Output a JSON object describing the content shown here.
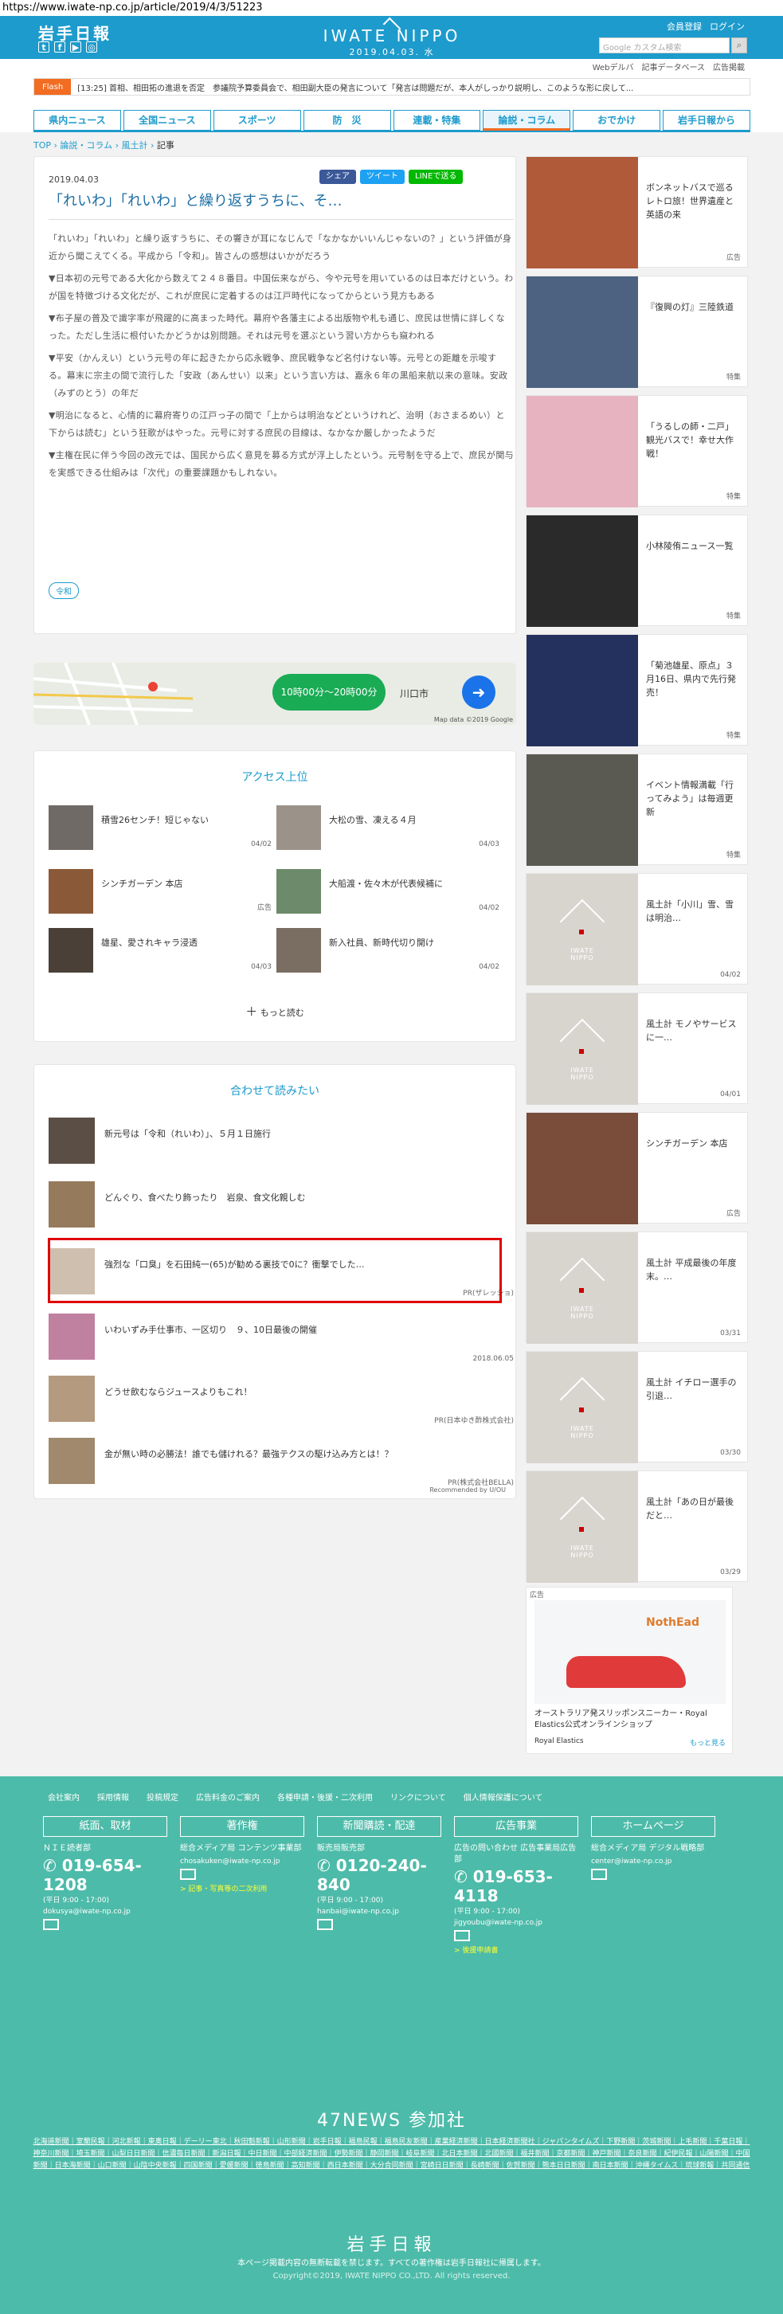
{
  "url": "https://www.iwate-np.co.jp/article/2019/4/3/51223",
  "header": {
    "logo": "岩手日報",
    "site_name": "IWATE NIPPO",
    "date": "2019.04.03. 水",
    "member_register": "会員登録",
    "login": "ログイン",
    "search_placeholder": "Google カスタム検索",
    "subnav": [
      "Webデルバ",
      "記事データベース",
      "広告掲載"
    ]
  },
  "flash": {
    "label": "Flash",
    "text": "[13:25] 首相、相田拓の進退を否定　参議院予算委員会で、相田副大臣の発言について「発言は問題だが、本人がしっかり説明し、このような形に戻して..."
  },
  "nav": [
    "県内ニュース",
    "全国ニュース",
    "スポーツ",
    "防　災",
    "連載・特集",
    "論説・コラム",
    "おでかけ",
    "岩手日報から"
  ],
  "breadcrumb": [
    "TOP",
    "論説・コラム",
    "風土計",
    "記事"
  ],
  "article": {
    "date": "2019.04.03",
    "share": [
      "シェア",
      "ツイート",
      "LINEで送る"
    ],
    "title": "「れいわ」「れいわ」と繰り返すうちに、そ…",
    "paragraphs": [
      "「れいわ」「れいわ」と繰り返すうちに、その響きが耳になじんで「なかなかいいんじゃないの？」という評価が身近から聞こえてくる。平成から「令和」。皆さんの感想はいかがだろう",
      "▼日本初の元号である大化から数えて２４８番目。中国伝来ながら、今や元号を用いているのは日本だけという。わが国を特徴づける文化だが、これが庶民に定着するのは江戸時代になってからという見方もある",
      "▼布子屋の普及で識字率が飛躍的に高まった時代。幕府や各藩主による出版物や札も通じ、庶民は世情に詳しくなった。ただし生活に根付いたかどうかは別問題。それは元号を選ぶという習い方からも窺われる",
      "▼平安（かんえい）という元号の年に起きたから応永戦争、庶民戦争など名付けない等。元号との距離を示唆する。幕末に宗主の間で流行した「安政（あんせい）以来」という言い方は、嘉永６年の黒船来航以来の意味。安政（みずのとう）の年だ",
      "▼明治になると、心情的に幕府寄りの江戸っ子の間で「上からは明治などというけれど、治明（おさまるめい）と下からは読む」という狂歌がはやった。元号に対する庶民の目線は、なかなか厳しかったようだ",
      "▼主権在民に伴う今回の改元では、国民から広く意見を募る方式が浮上したという。元号制を守る上で、庶民が関与を実感できる仕組みは「次代」の重要課題かもしれない。"
    ],
    "tag": "令和"
  },
  "map": {
    "city_label": "川口市",
    "hours": "10時00分〜20時00分",
    "credit": "Map data ©2019 Google"
  },
  "access": {
    "title": "アクセス上位",
    "items": [
      {
        "text": "積雪26センチ！短じゃない",
        "date": "04/02"
      },
      {
        "text": "大松の雪、凍える４月",
        "date": "04/03"
      },
      {
        "text": "シンチガーデン 本店",
        "date": "広告"
      },
      {
        "text": "大船渡・佐々木が代表候補に",
        "date": "04/02"
      },
      {
        "text": "雄星、愛されキャラ浸透",
        "date": "04/03"
      },
      {
        "text": "新入社員、新時代切り開け",
        "date": "04/02"
      }
    ],
    "more": "もっと読む"
  },
  "related": {
    "title": "合わせて読みたい",
    "items": [
      {
        "text": "新元号は「令和（れいわ）」、５月１日施行",
        "sub": ""
      },
      {
        "text": "どんぐり、食べたり飾ったり　岩泉、食文化親しむ",
        "sub": ""
      },
      {
        "text": "強烈な「口臭」を石田純一(65)が勧める裏技で0に？衝撃でした…",
        "sub": "PR(ザレッショ)"
      },
      {
        "text": "いわいずみ手仕事市、一区切り　９、10日最後の開催",
        "sub": "2018.06.05"
      },
      {
        "text": "どうせ飲むならジュースよりもこれ！",
        "sub": "PR(日本ゆき酢株式会社)"
      },
      {
        "text": "金が無い時の必勝法！誰でも儲けれる？最強テクスの駆け込み方とは！？",
        "sub": "PR(株式会社BELLA)"
      }
    ],
    "recommended": "Recommended by U/OU"
  },
  "sidebar": [
    {
      "text": "ボンネットバスで巡るレトロ旅！世界遺産と英語の来",
      "label": "広告"
    },
    {
      "text": "『復興の灯』三陸鉄道",
      "label": "特集"
    },
    {
      "text": "「うるしの師・二戸」観光バスで！幸せ大作戦！",
      "label": "特集"
    },
    {
      "text": "小林陵侑ニュース一覧",
      "label": "特集"
    },
    {
      "text": "「菊池雄星、原点」３月16日、県内で先行発売！",
      "label": "特集"
    },
    {
      "text": "イベント情報満載「行ってみよう」は毎週更新",
      "label": "特集"
    },
    {
      "text": "風土計「小川」雪、雪は明治…",
      "label": "04/02"
    },
    {
      "text": "風土計 モノやサービスに一…",
      "label": "04/01"
    },
    {
      "text": "シンチガーデン 本店",
      "label": "広告"
    },
    {
      "text": "風土計 平成最後の年度末。…",
      "label": "03/31"
    },
    {
      "text": "風土計 イチロー選手の引退…",
      "label": "03/30"
    },
    {
      "text": "風土計「あの日が最後だと…",
      "label": "03/29"
    }
  ],
  "ad": {
    "label": "広告",
    "text": "オーストラリア発スリッポンスニーカー・Royal Elastics公式オンラインショップ",
    "brand": "Royal Elastics",
    "more": "もっと見る"
  },
  "footer": {
    "links": [
      "会社案内",
      "採用情報",
      "投稿規定",
      "広告料金のご案内",
      "各種申請・後援・二次利用",
      "リンクについて",
      "個人情報保護について"
    ],
    "columns": [
      {
        "title": "紙面、取材",
        "l1": "ＮＩＥ読者部",
        "phone": "019-654-1208",
        "hours": "(平日 9:00 - 17:00)",
        "email": "dokusya@iwate-np.co.jp",
        "extra": ""
      },
      {
        "title": "著作権",
        "l1": "総合メディア局 コンテンツ事業部",
        "phone": "",
        "hours": "",
        "email": "chosakuken@iwate-np.co.jp",
        "extra": "> 記事・写真等の二次利用"
      },
      {
        "title": "新聞購読・配達",
        "l1": "販売局販売部",
        "phone": "0120-240-840",
        "hours": "(平日 9:00 - 17:00)",
        "email": "hanbai@iwate-np.co.jp",
        "extra": ""
      },
      {
        "title": "広告事業",
        "l1": "広告の問い合わせ 広告事業局広告部",
        "phone": "019-653-4118",
        "hours": "(平日 9:00 - 17:00)",
        "email": "jigyoubu@iwate-np.co.jp",
        "extra": "> 後援申請書"
      },
      {
        "title": "ホームページ",
        "l1": "総合メディア局 デジタル戦略部",
        "phone": "",
        "hours": "",
        "email": "center@iwate-np.co.jp",
        "extra": ""
      }
    ],
    "n47": "47NEWS 参加社",
    "papers": "北海道新聞｜室蘭民報｜河北新報｜東奥日報｜デーリー東北｜秋田魁新報｜山形新聞｜岩手日報｜福島民報｜福島民友新聞｜産業経済新聞｜日本経済新聞社｜ジャパンタイムズ｜下野新聞｜茨城新聞｜上毛新聞｜千葉日報｜神奈川新聞｜埼玉新聞｜山梨日日新聞｜信濃毎日新聞｜新潟日報｜中日新聞｜中部経済新聞｜伊勢新聞｜静岡新聞｜岐阜新聞｜北日本新聞｜北國新聞｜福井新聞｜京都新聞｜神戸新聞｜奈良新聞｜紀伊民報｜山陽新聞｜中国新聞｜日本海新聞｜山口新聞｜山陰中央新報｜四国新聞｜愛媛新聞｜徳島新聞｜高知新聞｜西日本新聞｜大分合同新聞｜宮崎日日新聞｜長崎新聞｜佐賀新聞｜熊本日日新聞｜南日本新聞｜沖縄タイムス｜琉球新報｜共同通信",
    "logo": "岩手日報",
    "notice": "本ページ掲載内容の無断転載を禁じます。すべての著作権は岩手日報社に帰属します。",
    "copyright": "Copyright©2019, IWATE NIPPO CO.,LTD. All rights reserved."
  }
}
